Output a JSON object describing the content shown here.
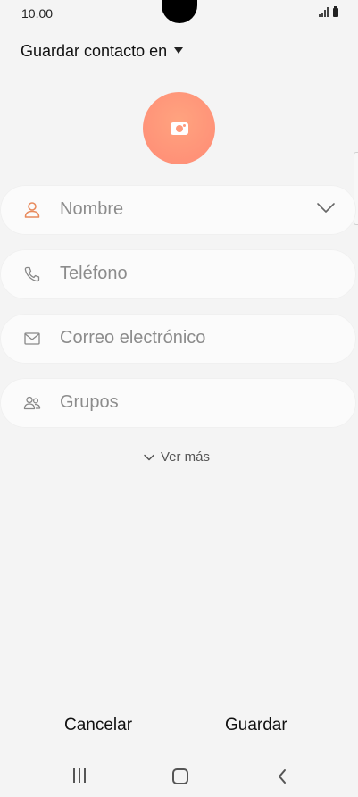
{
  "status_bar": {
    "time": "10.00"
  },
  "header": {
    "save_to_label": "Guardar contacto en"
  },
  "fields": {
    "name": {
      "placeholder": "Nombre"
    },
    "phone": {
      "placeholder": "Teléfono"
    },
    "email": {
      "placeholder": "Correo electrónico"
    },
    "groups": {
      "placeholder": "Grupos"
    }
  },
  "more": {
    "label": "Ver más"
  },
  "actions": {
    "cancel": "Cancelar",
    "save": "Guardar"
  },
  "icons": {
    "photo": "camera-icon",
    "name": "person-icon",
    "phone": "phone-icon",
    "email": "envelope-icon",
    "groups": "group-icon"
  },
  "colors": {
    "accent": "#ff9a7c",
    "name_icon": "#e88a5c",
    "placeholder": "#8c8c8c",
    "background": "#f4f4f4"
  }
}
